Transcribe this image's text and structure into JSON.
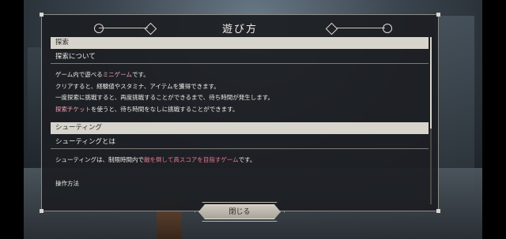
{
  "dialog": {
    "title": "遊び方",
    "close_label": "閉じる"
  },
  "sections": [
    {
      "header": "探索",
      "subheader": "探索について",
      "lines": [
        [
          {
            "t": "ゲーム内で遊べる"
          },
          {
            "t": "ミニゲーム",
            "hl": "pink"
          },
          {
            "t": "です。"
          }
        ],
        [
          {
            "t": "クリアすると、経験値やスタミナ、アイテムを獲得できます。"
          }
        ],
        [
          {
            "t": "一度探索に挑戦すると、再度挑戦することができるまで、待ち時間が発生します。"
          }
        ],
        [
          {
            "t": "探索チケット",
            "hl": "pink"
          },
          {
            "t": "を使うと、待ち時間をなしに挑戦することができます。"
          }
        ]
      ]
    },
    {
      "header": "シューティング",
      "subheader": "シューティングとは",
      "lines": [
        [
          {
            "t": "シューティングは、制限時間内で"
          },
          {
            "t": "敵を倒して高スコアを目指すゲーム",
            "hl": "red"
          },
          {
            "t": "です。"
          }
        ]
      ],
      "next_heading": "操作方法"
    }
  ],
  "colors": {
    "highlight_pink": "#f0a0b8",
    "highlight_red": "#e47a8e",
    "header_bg": "#d7d4cc"
  }
}
